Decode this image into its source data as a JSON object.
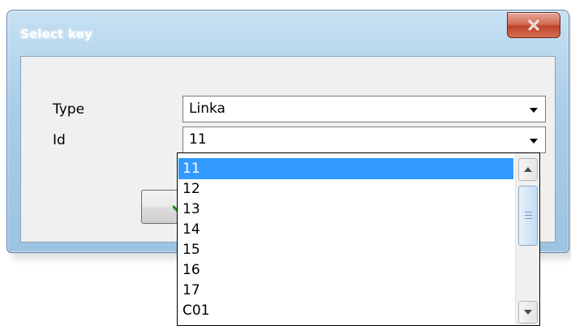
{
  "window": {
    "title": "Select key",
    "close_icon": "close-x-icon"
  },
  "form": {
    "type_label": "Type",
    "type_value": "Linka",
    "id_label": "Id",
    "id_value": "11"
  },
  "ok_button": {
    "icon": "green-checkmark-icon"
  },
  "dropdown": {
    "selected": "11",
    "options": [
      "11",
      "12",
      "13",
      "14",
      "15",
      "16",
      "17",
      "C01"
    ]
  },
  "colors": {
    "selection": "#3399ff",
    "close_button": "#c7472f",
    "title_glow": "#ffffff"
  }
}
